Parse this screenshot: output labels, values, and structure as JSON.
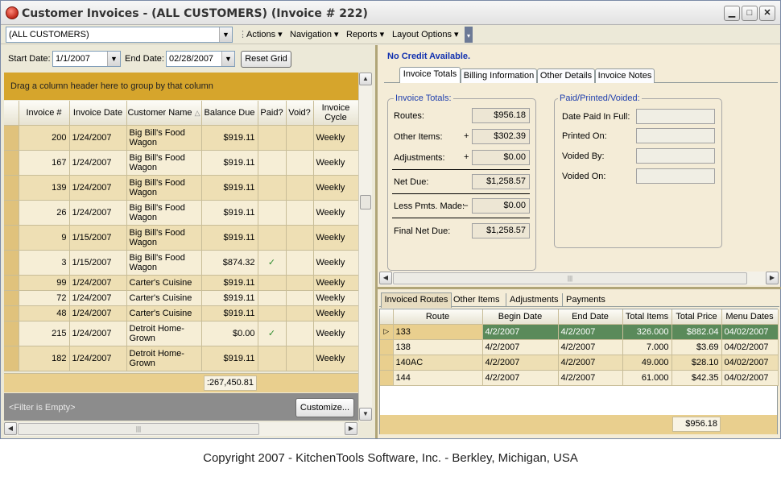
{
  "window": {
    "title": "Customer Invoices - (ALL CUSTOMERS) (Invoice # 222)"
  },
  "toolbar": {
    "customer_filter": "(ALL CUSTOMERS)",
    "menus": [
      "Actions",
      "Navigation",
      "Reports",
      "Layout Options"
    ]
  },
  "filters": {
    "start_label": "Start Date:",
    "start_value": "1/1/2007",
    "end_label": "End Date:",
    "end_value": "02/28/2007",
    "reset_label": "Reset Grid"
  },
  "grid": {
    "group_banner": "Drag a column header here to group by that column",
    "columns": [
      "Invoice #",
      "Invoice Date",
      "Customer Name",
      "Balance Due",
      "Paid?",
      "Void?",
      "Invoice Cycle"
    ],
    "rows": [
      {
        "invoice": "200",
        "date": "1/24/2007",
        "customer": "Big Bill's Food Wagon",
        "balance": "$919.11",
        "paid": "",
        "void": "",
        "cycle": "Weekly"
      },
      {
        "invoice": "167",
        "date": "1/24/2007",
        "customer": "Big Bill's Food Wagon",
        "balance": "$919.11",
        "paid": "",
        "void": "",
        "cycle": "Weekly"
      },
      {
        "invoice": "139",
        "date": "1/24/2007",
        "customer": "Big Bill's Food Wagon",
        "balance": "$919.11",
        "paid": "",
        "void": "",
        "cycle": "Weekly"
      },
      {
        "invoice": "26",
        "date": "1/24/2007",
        "customer": "Big Bill's Food Wagon",
        "balance": "$919.11",
        "paid": "",
        "void": "",
        "cycle": "Weekly"
      },
      {
        "invoice": "9",
        "date": "1/15/2007",
        "customer": "Big Bill's Food Wagon",
        "balance": "$919.11",
        "paid": "",
        "void": "",
        "cycle": "Weekly"
      },
      {
        "invoice": "3",
        "date": "1/15/2007",
        "customer": "Big Bill's Food Wagon",
        "balance": "$874.32",
        "paid": "✓",
        "void": "",
        "cycle": "Weekly"
      },
      {
        "invoice": "99",
        "date": "1/24/2007",
        "customer": "Carter's Cuisine",
        "balance": "$919.11",
        "paid": "",
        "void": "",
        "cycle": "Weekly"
      },
      {
        "invoice": "72",
        "date": "1/24/2007",
        "customer": "Carter's Cuisine",
        "balance": "$919.11",
        "paid": "",
        "void": "",
        "cycle": "Weekly"
      },
      {
        "invoice": "48",
        "date": "1/24/2007",
        "customer": "Carter's Cuisine",
        "balance": "$919.11",
        "paid": "",
        "void": "",
        "cycle": "Weekly"
      },
      {
        "invoice": "215",
        "date": "1/24/2007",
        "customer": "Detroit Home-Grown",
        "balance": "$0.00",
        "paid": "✓",
        "void": "",
        "cycle": "Weekly"
      },
      {
        "invoice": "182",
        "date": "1/24/2007",
        "customer": "Detroit Home-Grown",
        "balance": "$919.11",
        "paid": "",
        "void": "",
        "cycle": "Weekly"
      }
    ],
    "total_balance": ":267,450.81",
    "filter_text": "<Filter is Empty>",
    "customize_label": "Customize..."
  },
  "credit": {
    "message": "No Credit Available."
  },
  "detail_tabs": [
    "Invoice Totals",
    "Billing Information",
    "Other Details",
    "Invoice Notes"
  ],
  "totals": {
    "group_label": "Invoice Totals:",
    "routes_label": "Routes:",
    "routes_value": "$956.18",
    "other_label": "Other Items:",
    "other_value": "$302.39",
    "adj_label": "Adjustments:",
    "adj_value": "$0.00",
    "net_label": "Net Due:",
    "net_value": "$1,258.57",
    "pmts_label": "Less Pmts. Made:",
    "pmts_value": "$0.00",
    "final_label": "Final Net Due:",
    "final_value": "$1,258.57",
    "plus": "+",
    "minus": "–"
  },
  "ppv": {
    "group_label": "Paid/Printed/Voided:",
    "paid_label": "Date Paid In Full:",
    "printed_label": "Printed On:",
    "voided_by_label": "Voided By:",
    "voided_on_label": "Voided On:"
  },
  "bottom_tabs": [
    "Invoiced Routes",
    "Other Items",
    "Adjustments",
    "Payments"
  ],
  "routes": {
    "columns": [
      "Route",
      "Begin Date",
      "End Date",
      "Total Items",
      "Total Price",
      "Menu Dates"
    ],
    "rows": [
      {
        "route": "133",
        "begin": "4/2/2007",
        "end": "4/2/2007",
        "items": "326.000",
        "price": "$882.04",
        "menu": "04/02/2007"
      },
      {
        "route": "138",
        "begin": "4/2/2007",
        "end": "4/2/2007",
        "items": "7.000",
        "price": "$3.69",
        "menu": "04/02/2007"
      },
      {
        "route": "140AC",
        "begin": "4/2/2007",
        "end": "4/2/2007",
        "items": "49.000",
        "price": "$28.10",
        "menu": "04/02/2007"
      },
      {
        "route": "144",
        "begin": "4/2/2007",
        "end": "4/2/2007",
        "items": "61.000",
        "price": "$42.35",
        "menu": "04/02/2007"
      }
    ],
    "total_price": "$956.18"
  },
  "footer": {
    "copyright": "Copyright 2007 - KitchenTools Software, Inc. - Berkley, Michigan, USA"
  }
}
